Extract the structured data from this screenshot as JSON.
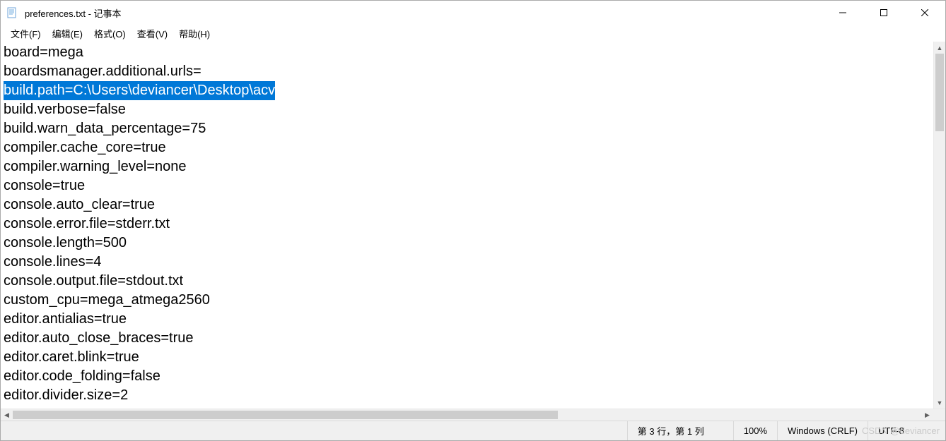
{
  "window": {
    "title": "preferences.txt - 记事本"
  },
  "menu": {
    "file": "文件(F)",
    "edit": "编辑(E)",
    "format": "格式(O)",
    "view": "查看(V)",
    "help": "帮助(H)"
  },
  "editor": {
    "selected_index": 2,
    "lines": [
      "board=mega",
      "boardsmanager.additional.urls=",
      "build.path=C:\\Users\\deviancer\\Desktop\\acv",
      "build.verbose=false",
      "build.warn_data_percentage=75",
      "compiler.cache_core=true",
      "compiler.warning_level=none",
      "console=true",
      "console.auto_clear=true",
      "console.error.file=stderr.txt",
      "console.length=500",
      "console.lines=4",
      "console.output.file=stdout.txt",
      "custom_cpu=mega_atmega2560",
      "editor.antialias=true",
      "editor.auto_close_braces=true",
      "editor.caret.blink=true",
      "editor.code_folding=false",
      "editor.divider.size=2"
    ]
  },
  "status": {
    "position": "第 3 行，第 1 列",
    "zoom": "100%",
    "line_ending": "Windows (CRLF)",
    "encoding": "UTF-8"
  },
  "watermark": "CSDN @deviancer"
}
